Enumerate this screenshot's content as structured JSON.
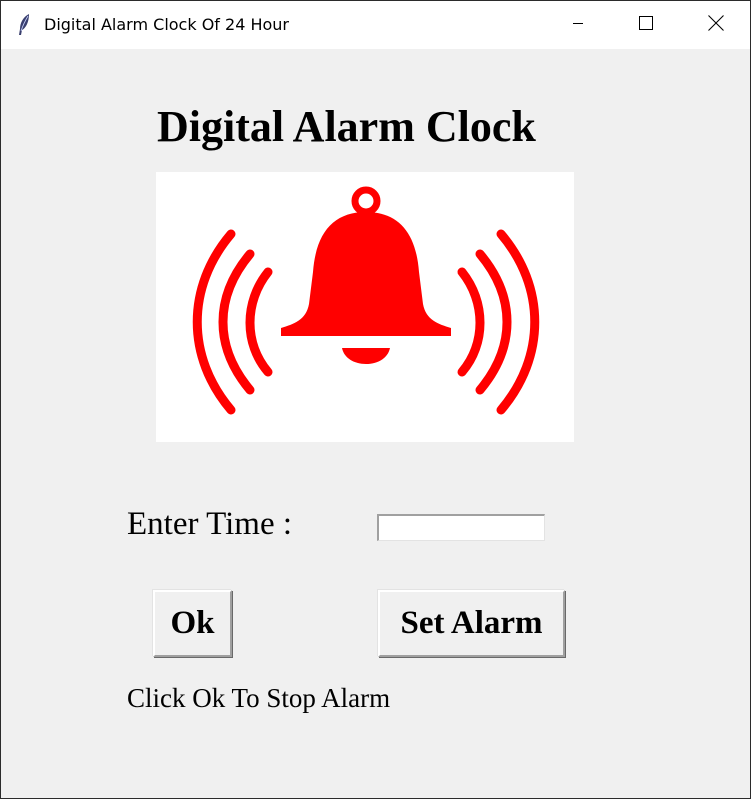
{
  "window": {
    "title": "Digital Alarm Clock Of 24 Hour",
    "app_icon": "feather-icon",
    "controls": {
      "minimize_icon": "minimize-icon",
      "maximize_icon": "maximize-icon",
      "close_icon": "close-icon"
    }
  },
  "main": {
    "heading": "Digital Alarm Clock",
    "image": {
      "icon": "ringing-bell-icon",
      "color": "#ff0000"
    },
    "time_label": "Enter Time :",
    "time_input": {
      "value": "",
      "placeholder": ""
    },
    "ok_label": "Ok",
    "set_alarm_label": "Set Alarm",
    "hint": "Click Ok To Stop Alarm"
  }
}
